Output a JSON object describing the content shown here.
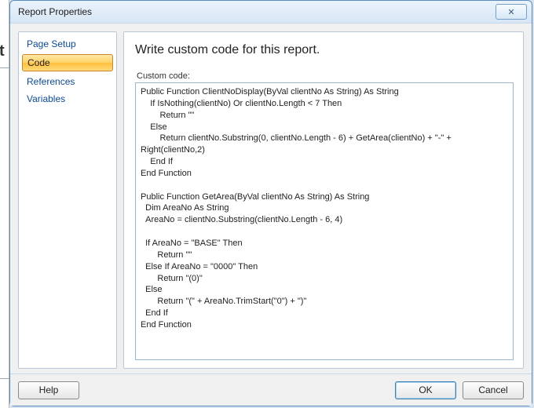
{
  "window": {
    "title": "Report Properties"
  },
  "sidebar": {
    "items": [
      {
        "label": "Page Setup",
        "selected": false
      },
      {
        "label": "Code",
        "selected": true
      },
      {
        "label": "References",
        "selected": false
      },
      {
        "label": "Variables",
        "selected": false
      }
    ]
  },
  "main": {
    "heading": "Write custom code for this report.",
    "field_label": "Custom code:",
    "code": "Public Function ClientNoDisplay(ByVal clientNo As String) As String\n    If IsNothing(clientNo) Or clientNo.Length < 7 Then\n        Return \"\"\n    Else\n        Return clientNo.Substring(0, clientNo.Length - 6) + GetArea(clientNo) + \"-\" + Right(clientNo,2)\n    End If\nEnd Function\n\nPublic Function GetArea(ByVal clientNo As String) As String\n  Dim AreaNo As String\n  AreaNo = clientNo.Substring(clientNo.Length - 6, 4)\n\n  If AreaNo = \"BASE\" Then\n       Return \"\"\n  Else If AreaNo = \"0000\" Then\n       Return \"(0)\"\n  Else\n       Return \"(\" + AreaNo.TrimStart(\"0\") + \")\"\n  End If\nEnd Function"
  },
  "footer": {
    "help": "Help",
    "ok": "OK",
    "cancel": "Cancel"
  }
}
